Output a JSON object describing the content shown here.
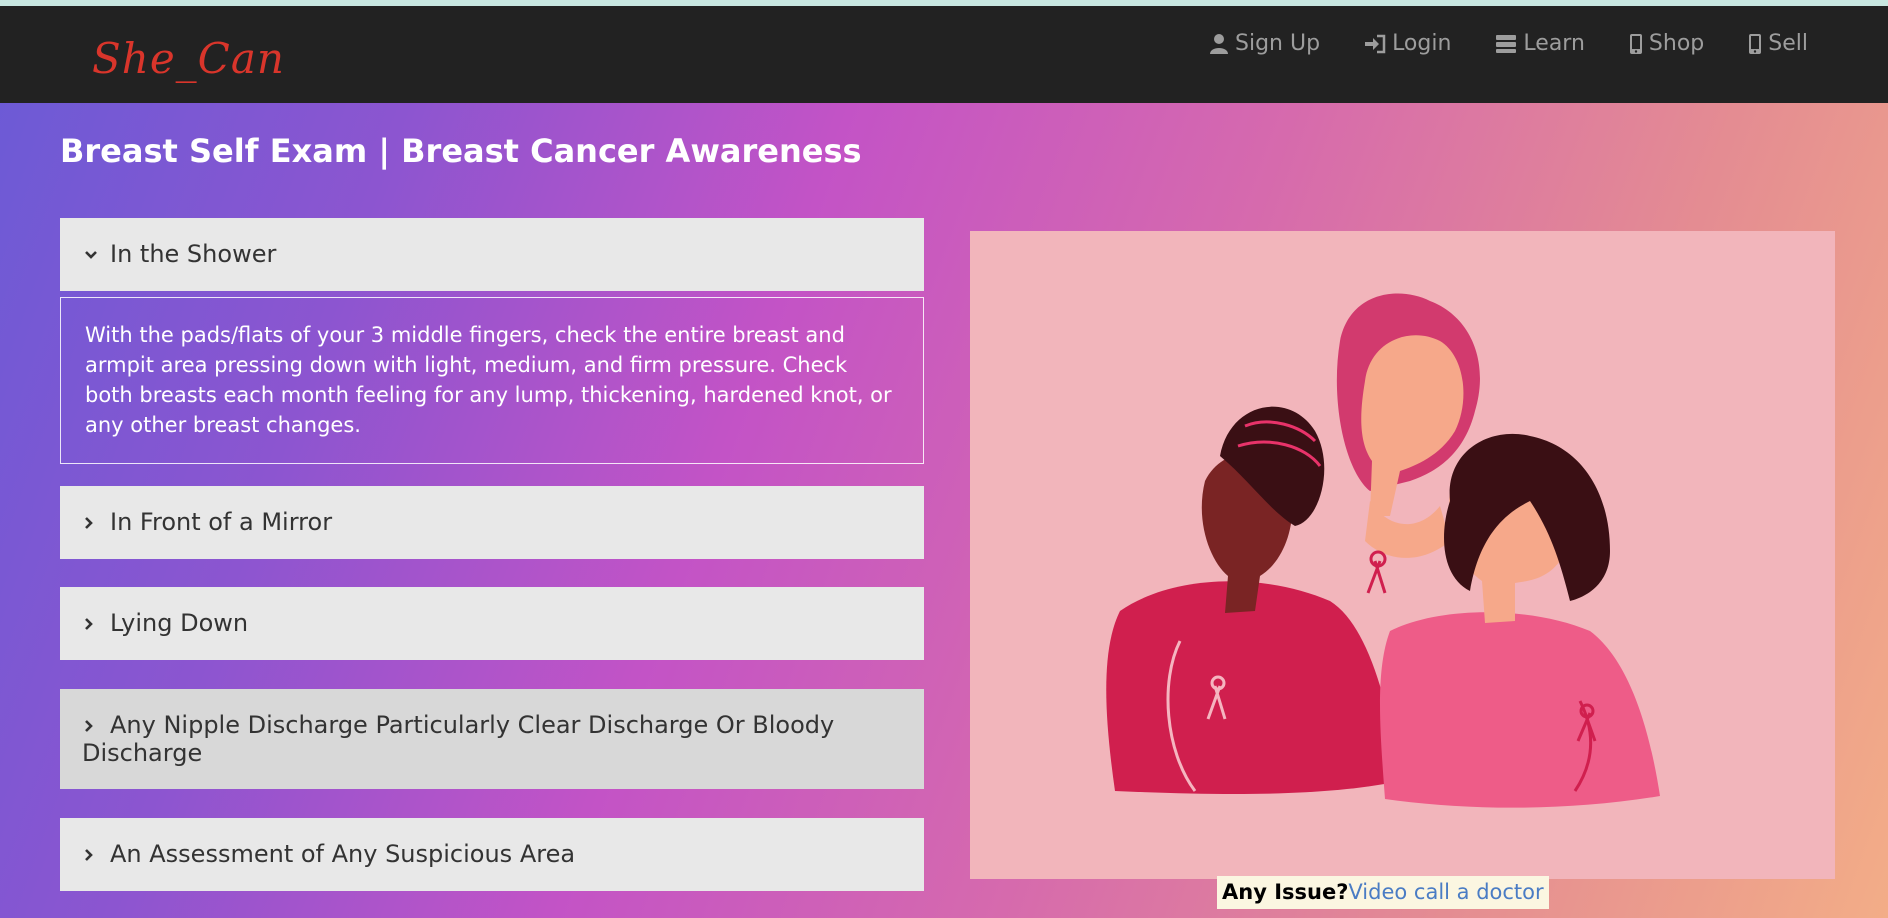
{
  "brand": "She_Can",
  "nav": [
    {
      "label": "Sign Up",
      "icon": "user-icon"
    },
    {
      "label": "Login",
      "icon": "login-icon"
    },
    {
      "label": "Learn",
      "icon": "server-icon"
    },
    {
      "label": "Shop",
      "icon": "phone-icon"
    },
    {
      "label": "Sell",
      "icon": "phone-icon"
    }
  ],
  "page_title": "Breast Self Exam | Breast Cancer Awareness",
  "accordion": [
    {
      "label": "In the Shower",
      "expanded": true,
      "content": "With the pads/flats of your 3 middle fingers, check the entire breast and armpit area pressing down with light, medium, and firm pressure. Check both breasts each month feeling for any lump, thickening, hardened knot, or any other breast changes."
    },
    {
      "label": "In Front of a Mirror",
      "expanded": false
    },
    {
      "label": "Lying Down",
      "expanded": false
    },
    {
      "label": "Any Nipple Discharge Particularly Clear Discharge Or Bloody Discharge",
      "expanded": false
    },
    {
      "label": "An Assessment of Any Suspicious Area",
      "expanded": false
    }
  ],
  "footer_cta": {
    "question": "Any Issue?",
    "link": "Video call a doctor"
  },
  "colors": {
    "navbar": "#222222",
    "brand": "#d9352b",
    "accordion_bg": "#e8e8e8",
    "image_bg": "#f2b5bb",
    "link": "#4a7cc4"
  }
}
